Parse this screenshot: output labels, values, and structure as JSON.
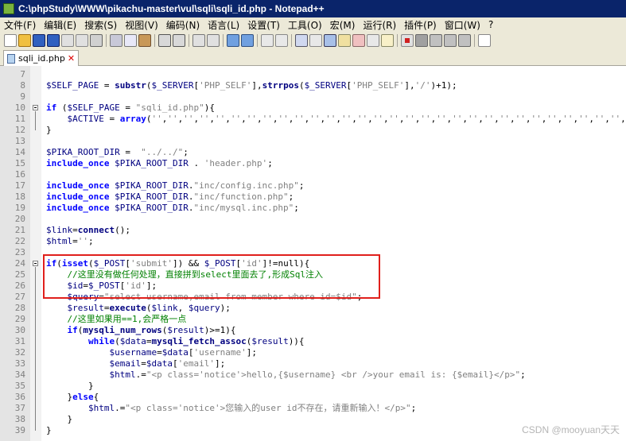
{
  "window": {
    "title": "C:\\phpStudy\\WWW\\pikachu-master\\vul\\sqli\\sqli_id.php - Notepad++"
  },
  "menu": [
    "文件(F)",
    "编辑(E)",
    "搜索(S)",
    "视图(V)",
    "编码(N)",
    "语言(L)",
    "设置(T)",
    "工具(O)",
    "宏(M)",
    "运行(R)",
    "插件(P)",
    "窗口(W)",
    "?"
  ],
  "tab": {
    "label": "sqli_id.php"
  },
  "lines": [
    {
      "n": "7",
      "t": ""
    },
    {
      "n": "8",
      "t": "$SELF_PAGE = substr($_SERVER['PHP_SELF'],strrpos($_SERVER['PHP_SELF'],'/')+1);"
    },
    {
      "n": "9",
      "t": ""
    },
    {
      "n": "10",
      "t": "if ($SELF_PAGE = \"sqli_id.php\"){"
    },
    {
      "n": "11",
      "t": "    $ACTIVE = array('','','','','','','','','','','','','','','','','','','','','','','','','','','','','','',"
    },
    {
      "n": "12",
      "t": "}"
    },
    {
      "n": "13",
      "t": ""
    },
    {
      "n": "14",
      "t": "$PIKA_ROOT_DIR =  \"../../\";"
    },
    {
      "n": "15",
      "t": "include_once $PIKA_ROOT_DIR . 'header.php';"
    },
    {
      "n": "16",
      "t": ""
    },
    {
      "n": "17",
      "t": "include_once $PIKA_ROOT_DIR.\"inc/config.inc.php\";"
    },
    {
      "n": "18",
      "t": "include_once $PIKA_ROOT_DIR.\"inc/function.php\";"
    },
    {
      "n": "19",
      "t": "include_once $PIKA_ROOT_DIR.\"inc/mysql.inc.php\";"
    },
    {
      "n": "20",
      "t": ""
    },
    {
      "n": "21",
      "t": "$link=connect();"
    },
    {
      "n": "22",
      "t": "$html='';"
    },
    {
      "n": "23",
      "t": ""
    },
    {
      "n": "24",
      "t": "if(isset($_POST['submit']) && $_POST['id']!=null){"
    },
    {
      "n": "25",
      "t": "    //这里没有做任何处理，直接拼到select里面去了,形成Sql注入"
    },
    {
      "n": "26",
      "t": "    $id=$_POST['id'];"
    },
    {
      "n": "27",
      "t": "    $query=\"select username,email from member where id=$id\";"
    },
    {
      "n": "28",
      "t": "    $result=execute($link, $query);"
    },
    {
      "n": "29",
      "t": "    //这里如果用==1,会严格一点"
    },
    {
      "n": "30",
      "t": "    if(mysqli_num_rows($result)>=1){"
    },
    {
      "n": "31",
      "t": "        while($data=mysqli_fetch_assoc($result)){"
    },
    {
      "n": "32",
      "t": "            $username=$data['username'];"
    },
    {
      "n": "33",
      "t": "            $email=$data['email'];"
    },
    {
      "n": "34",
      "t": "            $html.=\"<p class='notice'>hello,{$username} <br />your email is: {$email}</p>\";"
    },
    {
      "n": "35",
      "t": "        }"
    },
    {
      "n": "36",
      "t": "    }else{"
    },
    {
      "n": "37",
      "t": "        $html.=\"<p class='notice'>您输入的user id不存在，请重新输入！</p>\";"
    },
    {
      "n": "38",
      "t": "    }"
    },
    {
      "n": "39",
      "t": "}"
    }
  ],
  "watermark": "CSDN @mooyuan天天"
}
